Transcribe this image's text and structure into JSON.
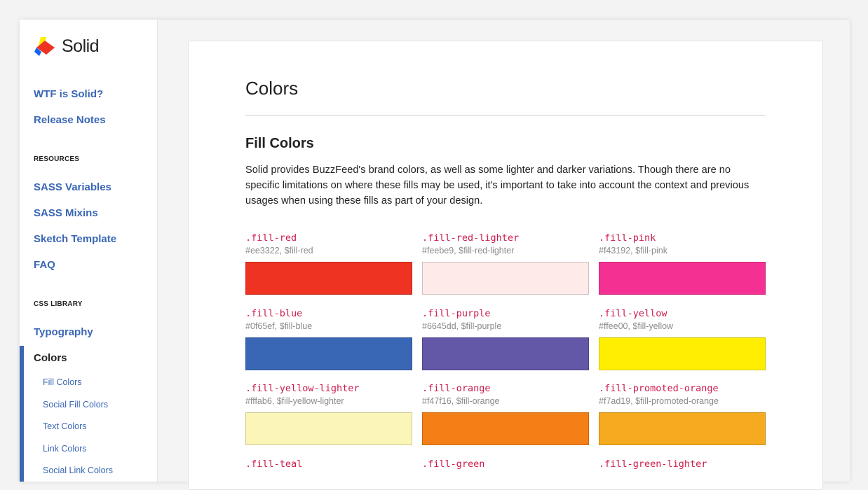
{
  "brand": {
    "name": "Solid",
    "logo_colors": [
      "#ffee00",
      "#ee3322",
      "#0f65ef"
    ]
  },
  "sidebar": {
    "top_links": [
      "WTF is Solid?",
      "Release Notes"
    ],
    "resources_heading": "RESOURCES",
    "resources_links": [
      "SASS Variables",
      "SASS Mixins",
      "Sketch Template",
      "FAQ"
    ],
    "css_library_heading": "CSS LIBRARY",
    "css_library_links": [
      "Typography"
    ],
    "active_item": "Colors",
    "sub_links": [
      "Fill Colors",
      "Social Fill Colors",
      "Text Colors",
      "Link Colors",
      "Social Link Colors"
    ],
    "accent_color": "#3a67b5"
  },
  "main": {
    "title": "Colors",
    "section_title": "Fill Colors",
    "intro": "Solid provides BuzzFeed's brand colors, as well as some lighter and darker variations. Though there are no specific limitations on where these fills may be used, it's important to take into account the context and previous usages when using these fills as part of your design.",
    "swatches": [
      {
        "class_name": ".fill-red",
        "meta": "#ee3322, $fill-red",
        "color": "#ee3322"
      },
      {
        "class_name": ".fill-red-lighter",
        "meta": "#feebe9, $fill-red-lighter",
        "color": "#feebe9"
      },
      {
        "class_name": ".fill-pink",
        "meta": "#f43192, $fill-pink",
        "color": "#f43192"
      },
      {
        "class_name": ".fill-blue",
        "meta": "#0f65ef, $fill-blue",
        "color": "#3a67b5"
      },
      {
        "class_name": ".fill-purple",
        "meta": "#6645dd, $fill-purple",
        "color": "#6357a8"
      },
      {
        "class_name": ".fill-yellow",
        "meta": "#ffee00, $fill-yellow",
        "color": "#ffee00"
      },
      {
        "class_name": ".fill-yellow-lighter",
        "meta": "#fffab6, $fill-yellow-lighter",
        "color": "#fbf5b8"
      },
      {
        "class_name": ".fill-orange",
        "meta": "#f47f16, $fill-orange",
        "color": "#f47f16"
      },
      {
        "class_name": ".fill-promoted-orange",
        "meta": "#f7ad19, $fill-promoted-orange",
        "color": "#f6aa1f"
      },
      {
        "class_name": ".fill-teal",
        "meta": "",
        "color": ""
      },
      {
        "class_name": ".fill-green",
        "meta": "",
        "color": ""
      },
      {
        "class_name": ".fill-green-lighter",
        "meta": "",
        "color": ""
      }
    ],
    "class_name_color": "#cc1a4a"
  }
}
